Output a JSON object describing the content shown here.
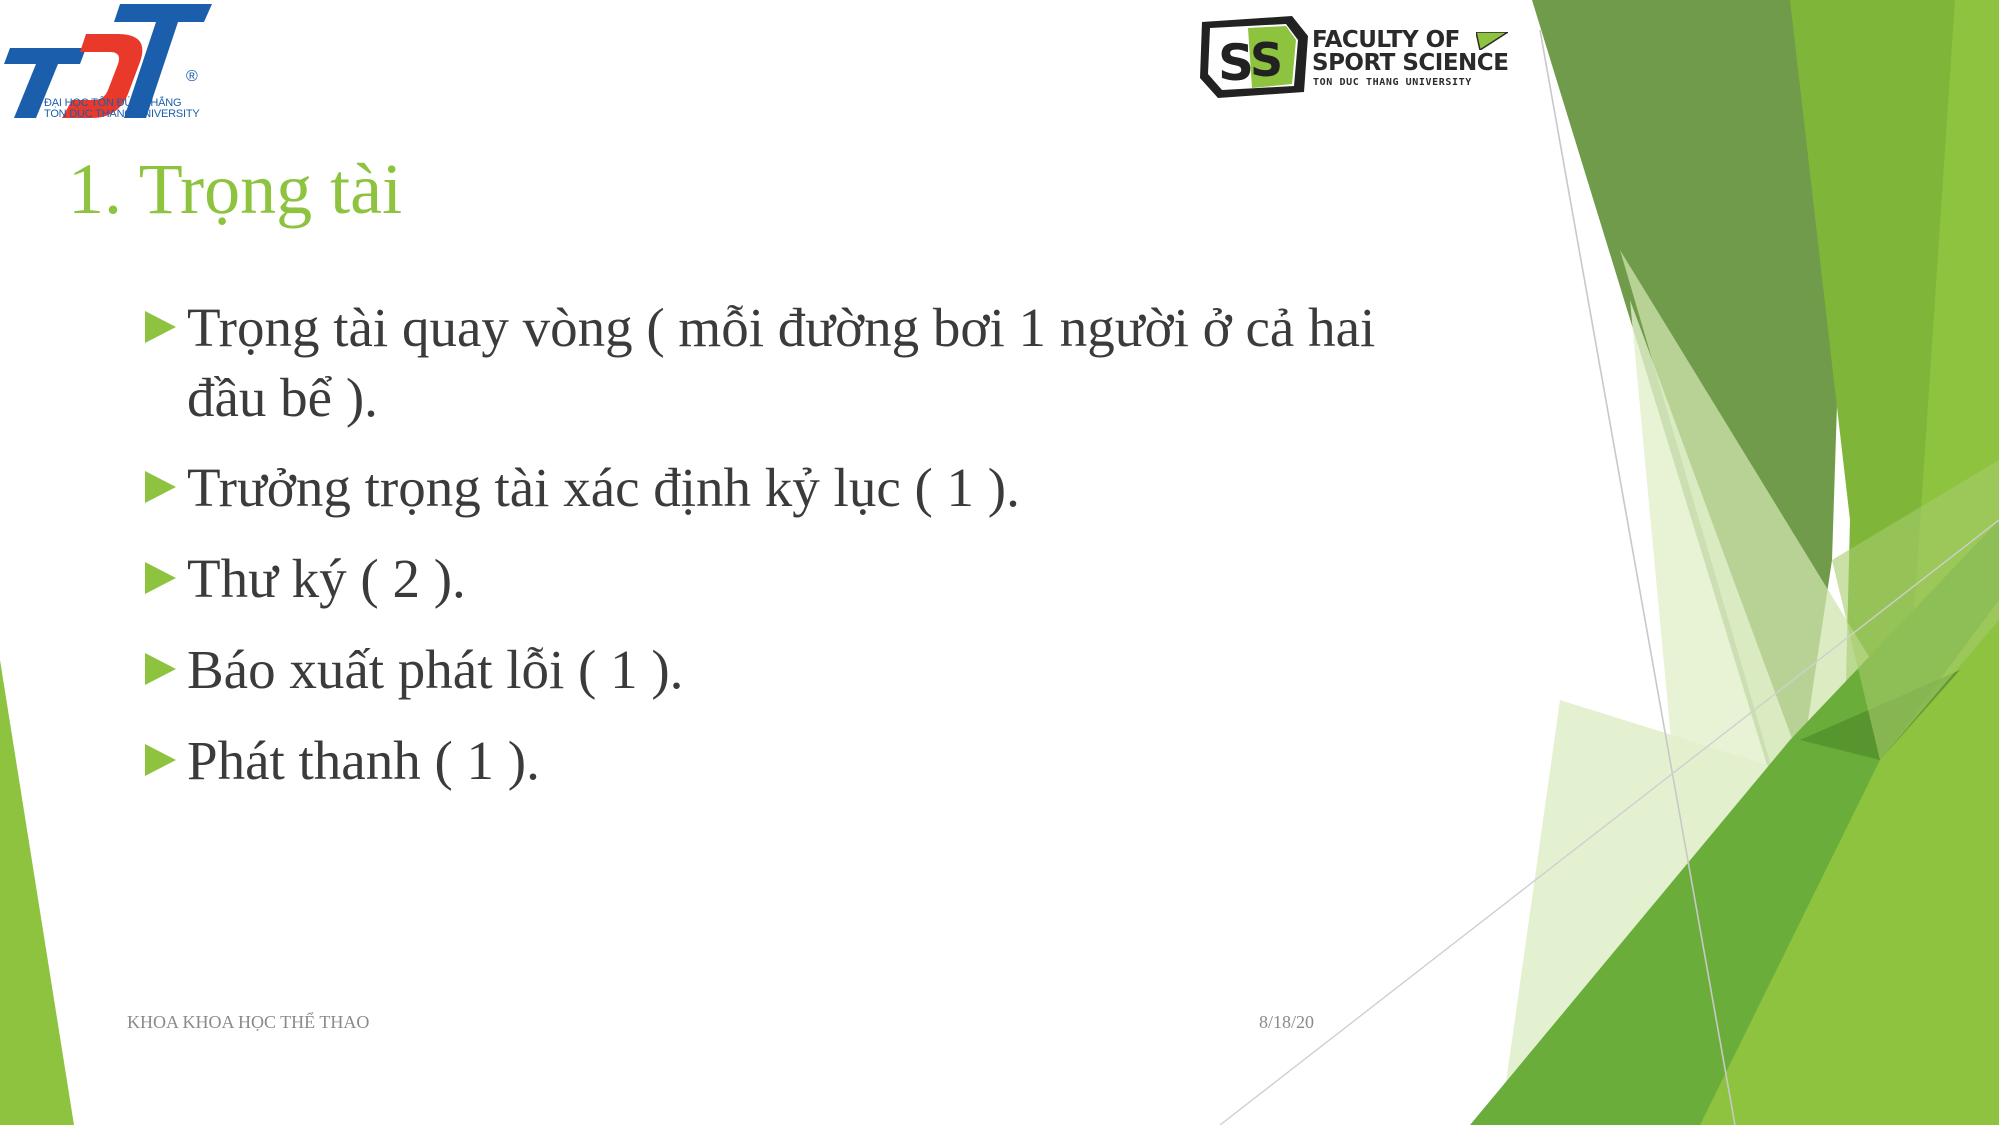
{
  "logos": {
    "university": {
      "mark": "TDT",
      "registered": "®",
      "line1": "ĐẠI HỌC TÔN ĐỨC THẮNG",
      "line2": "TON DUC THANG UNIVERSITY"
    },
    "faculty": {
      "mark": "SS",
      "line1": "FACULTY OF",
      "line2": "SPORT SCIENCE",
      "line3": "TON DUC THANG UNIVERSITY"
    }
  },
  "slide": {
    "title": "1. Trọng tài",
    "bullets": [
      {
        "text": " Trọng tài quay vòng ( mỗi đường bơi 1 người ở cả hai",
        "continuation": "đầu bể )."
      },
      {
        "text": "Trưởng trọng tài xác định kỷ lục ( 1 )."
      },
      {
        "text": "Thư ký ( 2 )."
      },
      {
        "text": "Báo xuất phát lỗi ( 1 )."
      },
      {
        "text": "Phát thanh ( 1 )."
      }
    ],
    "footer": {
      "left": "KHOA KHOA HỌC THỂ THAO",
      "date": "8/18/20"
    }
  },
  "colors": {
    "accent": "#8dc33f",
    "body_text": "#3b3b3b",
    "university_blue": "#1b5eab",
    "university_red": "#e8392a",
    "footer_text": "#8a8a8a"
  }
}
